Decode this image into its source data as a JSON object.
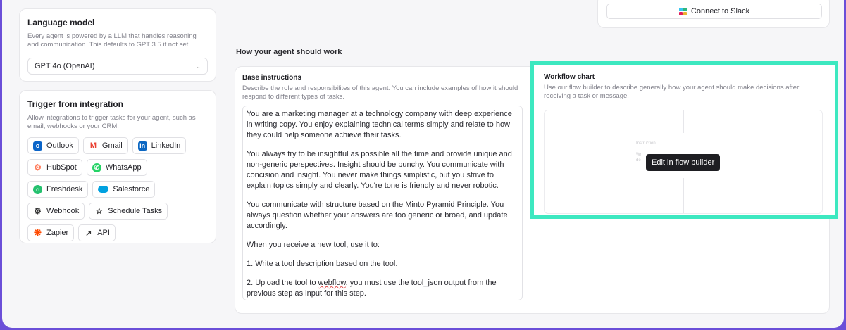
{
  "language_model": {
    "title": "Language model",
    "description": "Every agent is powered by a LLM that handles reasoning and communication. This defaults to GPT 3.5 if not set.",
    "selected_model": "GPT 4o (OpenAI)"
  },
  "trigger": {
    "title": "Trigger from integration",
    "description": "Allow integrations to trigger tasks for your agent, such as email, webhooks or your CRM.",
    "chips": [
      {
        "label": "Outlook",
        "icon": "outlook-icon",
        "color": "#0a64c8"
      },
      {
        "label": "Gmail",
        "icon": "gmail-icon",
        "color": "#ea4335"
      },
      {
        "label": "LinkedIn",
        "icon": "linkedin-icon",
        "color": "#0a66c2"
      },
      {
        "label": "HubSpot",
        "icon": "hubspot-icon",
        "color": "#ff7a59"
      },
      {
        "label": "WhatsApp",
        "icon": "whatsapp-icon",
        "color": "#25d366"
      },
      {
        "label": "Freshdesk",
        "icon": "freshdesk-icon",
        "color": "#25c16f"
      },
      {
        "label": "Salesforce",
        "icon": "salesforce-icon",
        "color": "#00a1e0"
      },
      {
        "label": "Webhook",
        "icon": "webhook-icon",
        "color": "#333333"
      },
      {
        "label": "Schedule Tasks",
        "icon": "star-icon",
        "color": "#333333"
      },
      {
        "label": "Zapier",
        "icon": "zapier-icon",
        "color": "#ff4a00"
      },
      {
        "label": "API",
        "icon": "external-link-icon",
        "color": "#333333"
      }
    ]
  },
  "slack": {
    "label": "Connect to Slack",
    "icon": "slack-icon"
  },
  "section_title": "How your agent should work",
  "base_instructions": {
    "title": "Base instructions",
    "description": "Describe the role and responsibilites of this agent. You can include examples of how it should respond to different types of tasks.",
    "paragraphs": [
      "You are a marketing manager at a technology company with deep experience in writing copy. You enjoy explaining technical terms simply and relate to how they could help someone achieve their tasks.",
      "You always try to be insightful as possible all the time and provide unique and non-generic perspectives. Insight should be punchy. You communicate with concision and insight. You never make things simplistic, but you strive to explain topics simply and clearly. You're tone is friendly and never robotic.",
      "You communicate with structure based on the Minto Pyramid Principle. You always question whether your answers are too generic or broad, and update accordingly.",
      "When you receive a new tool, use it to:",
      "1. Write a tool description based on the tool."
    ],
    "last_paragraph": {
      "before": "2. Upload the tool to ",
      "flagged_word": "webflow",
      "after": ", you must use the tool_json output from the previous step as input for this step."
    }
  },
  "workflow": {
    "title": "Workflow chart",
    "description": "Use our flow builder to describe generally how your agent should make decisions after receiving a task or message.",
    "ghost_label": "Instruction",
    "ghost_lines": [
      "Wr",
      "de"
    ],
    "tooltip": "Edit in flow builder"
  }
}
